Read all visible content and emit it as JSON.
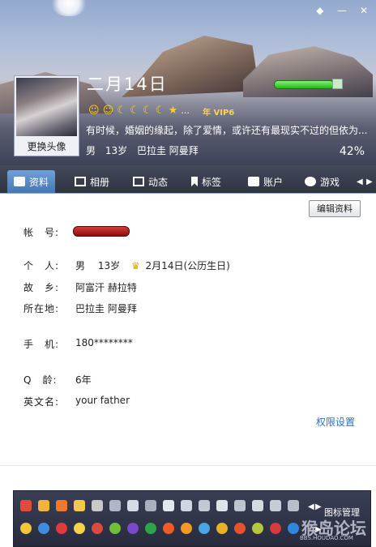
{
  "window": {
    "controls": [
      "◆",
      "—",
      "✕"
    ]
  },
  "header": {
    "nickname": "二月14日",
    "avatar_button": "更换头像",
    "vip_label": "年 VIP6",
    "signature": "有时候，婚姻的缘起，除了爱情，或许还有最现实不过的但依为...",
    "basic": [
      "男",
      "13岁",
      "巴拉圭 阿曼拜"
    ],
    "percent": "42%"
  },
  "tabs": [
    {
      "label": "资料",
      "icon": "profile-card-icon"
    },
    {
      "label": "相册",
      "icon": "photo-album-icon"
    },
    {
      "label": "动态",
      "icon": "feed-icon"
    },
    {
      "label": "标签",
      "icon": "bookmark-icon"
    },
    {
      "label": "账户",
      "icon": "briefcase-icon"
    },
    {
      "label": "游戏",
      "icon": "game-icon"
    }
  ],
  "profile": {
    "edit_button": "编辑资料",
    "account_label": "帐　号:",
    "personal_label": "个　人:",
    "personal_gender": "男",
    "personal_age": "13岁",
    "personal_birthday": "2月14日(公历生日)",
    "hometown_label": "故　乡:",
    "hometown_value": "阿富汗 赫拉特",
    "location_label": "所在地:",
    "location_value": "巴拉圭 阿曼拜",
    "phone_label": "手　机:",
    "phone_value": "180********",
    "qage_label": "Q　龄:",
    "qage_value": "6年",
    "english_label": "英文名:",
    "english_value": "your father",
    "permission_link": "权限设置"
  },
  "icon_panel": {
    "manage_label": "图标管理"
  },
  "watermark": {
    "logo": "猴岛论坛",
    "url": "BBS.HOUDAO.COM"
  }
}
